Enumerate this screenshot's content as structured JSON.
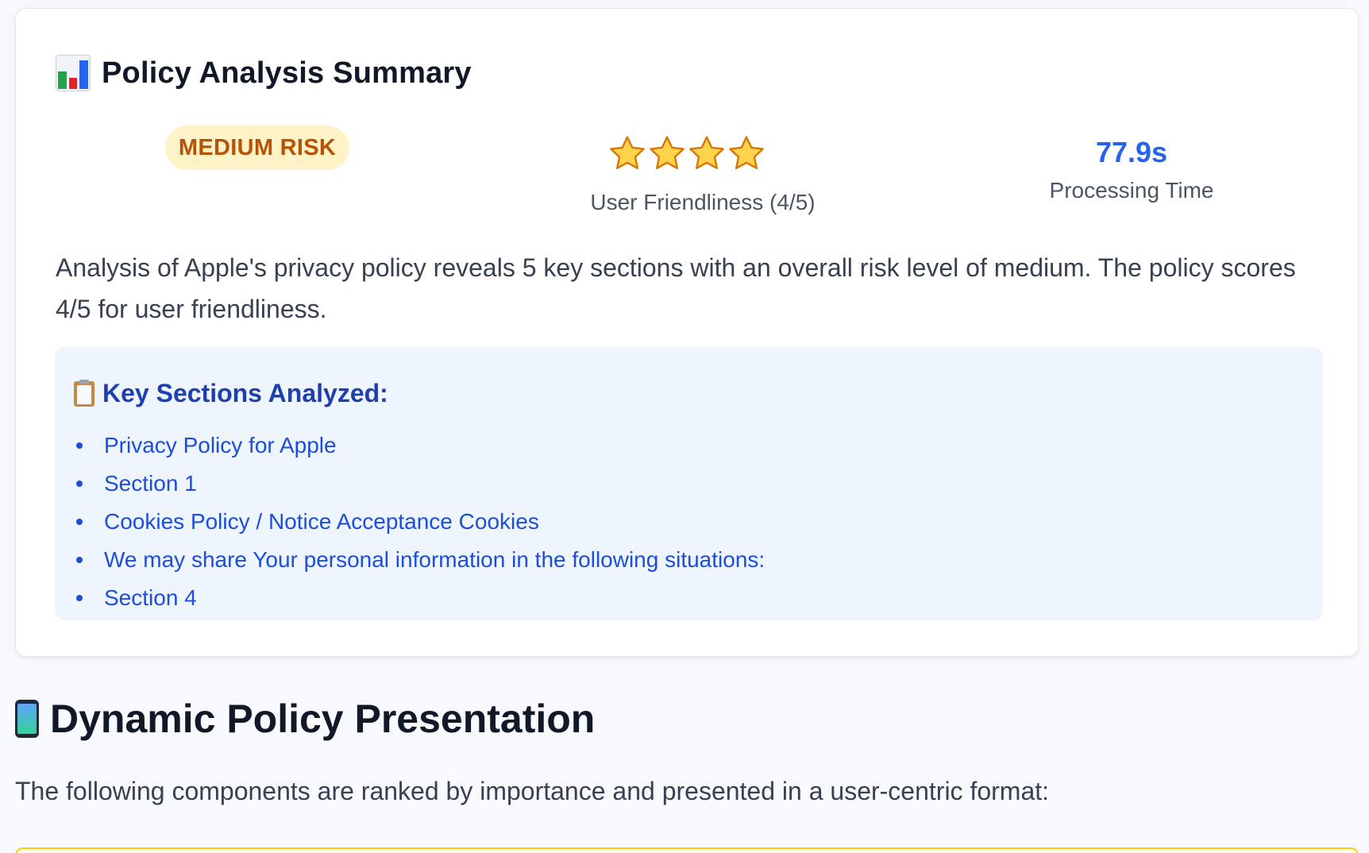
{
  "summary_card": {
    "title": "Policy Analysis Summary",
    "title_icon": "bar-chart-icon",
    "risk_badge": "MEDIUM RISK",
    "rating": {
      "stars": 4,
      "max": 5,
      "label": "User Friendliness (4/5)"
    },
    "processing_time": {
      "value": "77.9s",
      "label": "Processing Time"
    },
    "summary_text": "Analysis of Apple's privacy policy reveals 5 key sections with an overall risk level of medium. The policy scores 4/5 for user friendliness.",
    "key_sections": {
      "title": "Key Sections Analyzed:",
      "icon": "clipboard-icon",
      "items": [
        "Privacy Policy for Apple",
        "Section 1",
        "Cookies Policy / Notice Acceptance Cookies",
        "We may share Your personal information in the following situations:",
        "Section 4"
      ]
    }
  },
  "presentation": {
    "heading": "Dynamic Policy Presentation",
    "icon": "mobile-phone-icon",
    "intro": "The following components are ranked by importance and presented in a user-centric format:"
  },
  "colors": {
    "risk_bg": "#fef3c7",
    "risk_text": "#b45309",
    "accent_blue": "#2563eb",
    "section_bg": "#eef5fe",
    "section_text": "#1d4ed8"
  }
}
